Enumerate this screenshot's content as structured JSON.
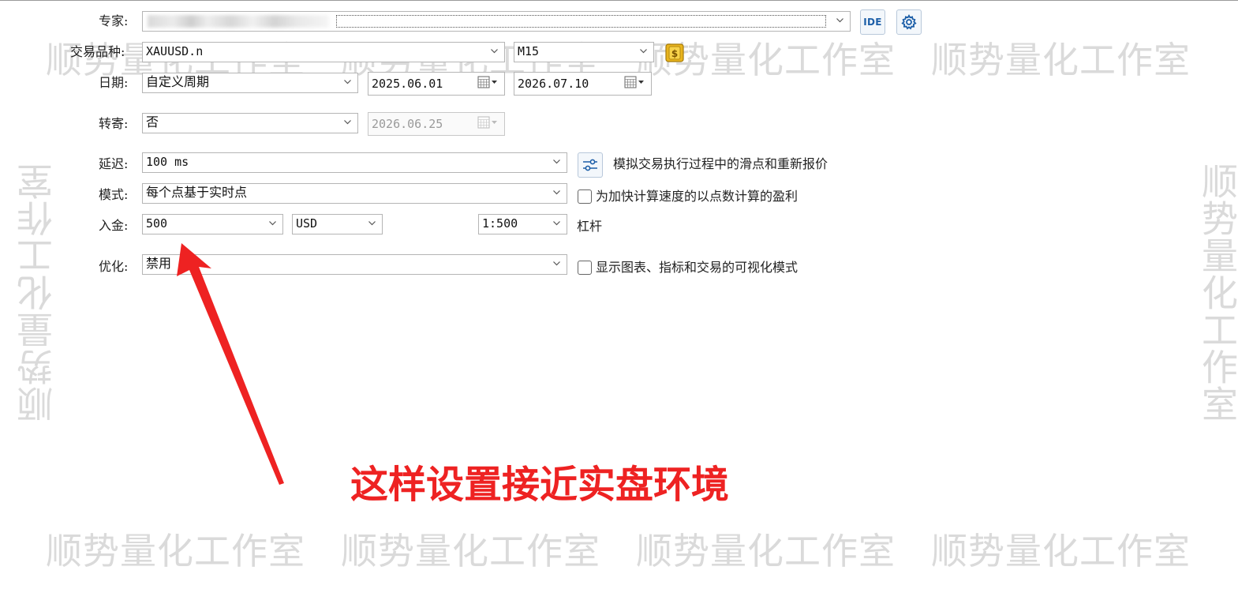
{
  "form": {
    "expert": {
      "label": "专家:"
    },
    "symbol": {
      "label": "交易品种:",
      "value": "XAUUSD.n",
      "timeframe": "M15"
    },
    "date": {
      "label": "日期:",
      "value": "自定义周期",
      "from": "2025.06.01",
      "to": "2026.07.10"
    },
    "forward": {
      "label": "转寄:",
      "value": "否",
      "date": "2026.06.25"
    },
    "delay": {
      "label": "延迟:",
      "value": "100 ms",
      "note": "模拟交易执行过程中的滑点和重新报价"
    },
    "mode": {
      "label": "模式:",
      "value": "每个点基于实时点",
      "checkbox_label": "为加快计算速度的以点数计算的盈利",
      "checked": false
    },
    "deposit": {
      "label": "入金:",
      "value": "500",
      "currency": "USD",
      "leverage": "1:500",
      "leverage_label": "杠杆"
    },
    "optimization": {
      "label": "优化:",
      "value": "禁用",
      "checkbox_label": "显示图表、指标和交易的可视化模式",
      "checked": false
    }
  },
  "buttons": {
    "ide": "IDE"
  },
  "watermark": "顺势量化工作室",
  "annotation": "这样设置接近实盘环境",
  "colors": {
    "annotation": "#ee2222",
    "ide_blue": "#1d5fa8",
    "coin_gold": "#e9b41d"
  },
  "icons": [
    "chevron-down-icon",
    "calendar-icon",
    "gear-icon",
    "coin-icon",
    "sliders-icon",
    "arrow-icon"
  ]
}
